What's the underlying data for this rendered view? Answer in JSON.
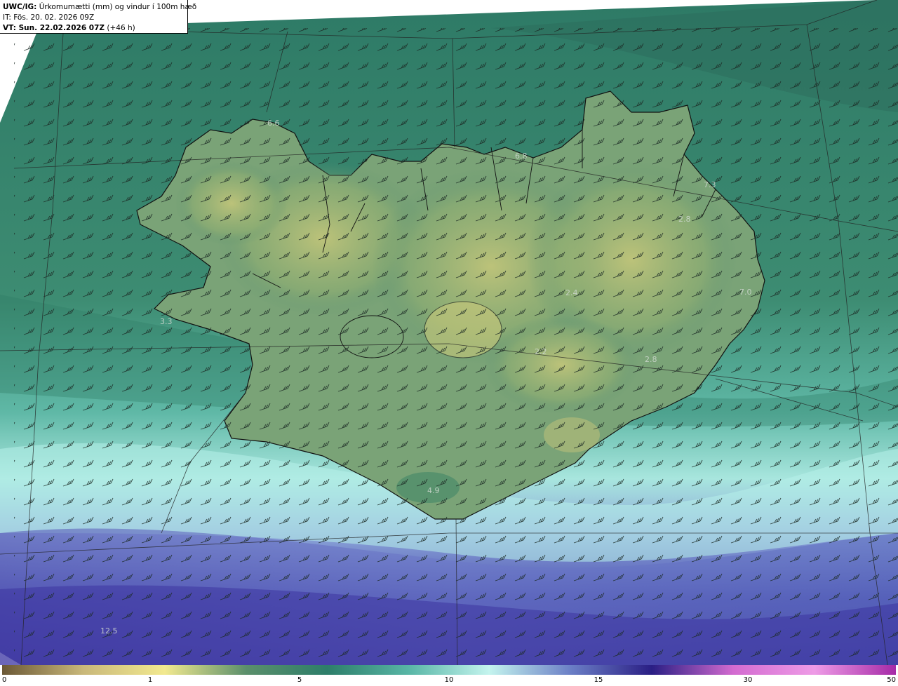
{
  "header": {
    "model_label": "UWC/IG:",
    "description": "Úrkomumætti (mm) og vindur í 100m hæð",
    "init_time": "IT: Fös. 20. 02. 2026 09Z",
    "valid_prefix": "VT: Sun. 22.02.2026 07Z",
    "valid_lead": "(+46 h)"
  },
  "value_labels": [
    {
      "id": "lbl-1",
      "text": "6.6"
    },
    {
      "id": "lbl-2",
      "text": "6.8"
    },
    {
      "id": "lbl-3",
      "text": "7.3"
    },
    {
      "id": "lbl-4",
      "text": "2.8"
    },
    {
      "id": "lbl-5",
      "text": "7.0"
    },
    {
      "id": "lbl-6",
      "text": "3.3"
    },
    {
      "id": "lbl-7",
      "text": "2.4"
    },
    {
      "id": "lbl-8",
      "text": "2.2"
    },
    {
      "id": "lbl-9",
      "text": "2.8"
    },
    {
      "id": "lbl-10",
      "text": "4.9"
    },
    {
      "id": "lbl-11",
      "text": "12.5"
    }
  ],
  "colorbar": {
    "ticks": [
      "0",
      "1",
      "5",
      "10",
      "15",
      "30",
      "50"
    ],
    "colors": [
      "#6b5836",
      "#c9b87a",
      "#f2e98f",
      "#5b8f6b",
      "#2d7e6a",
      "#58b6a6",
      "#c4f4ee",
      "#6b7fc6",
      "#2a1e84",
      "#d36bd0",
      "#ee9be6",
      "#a62aa7"
    ]
  }
}
